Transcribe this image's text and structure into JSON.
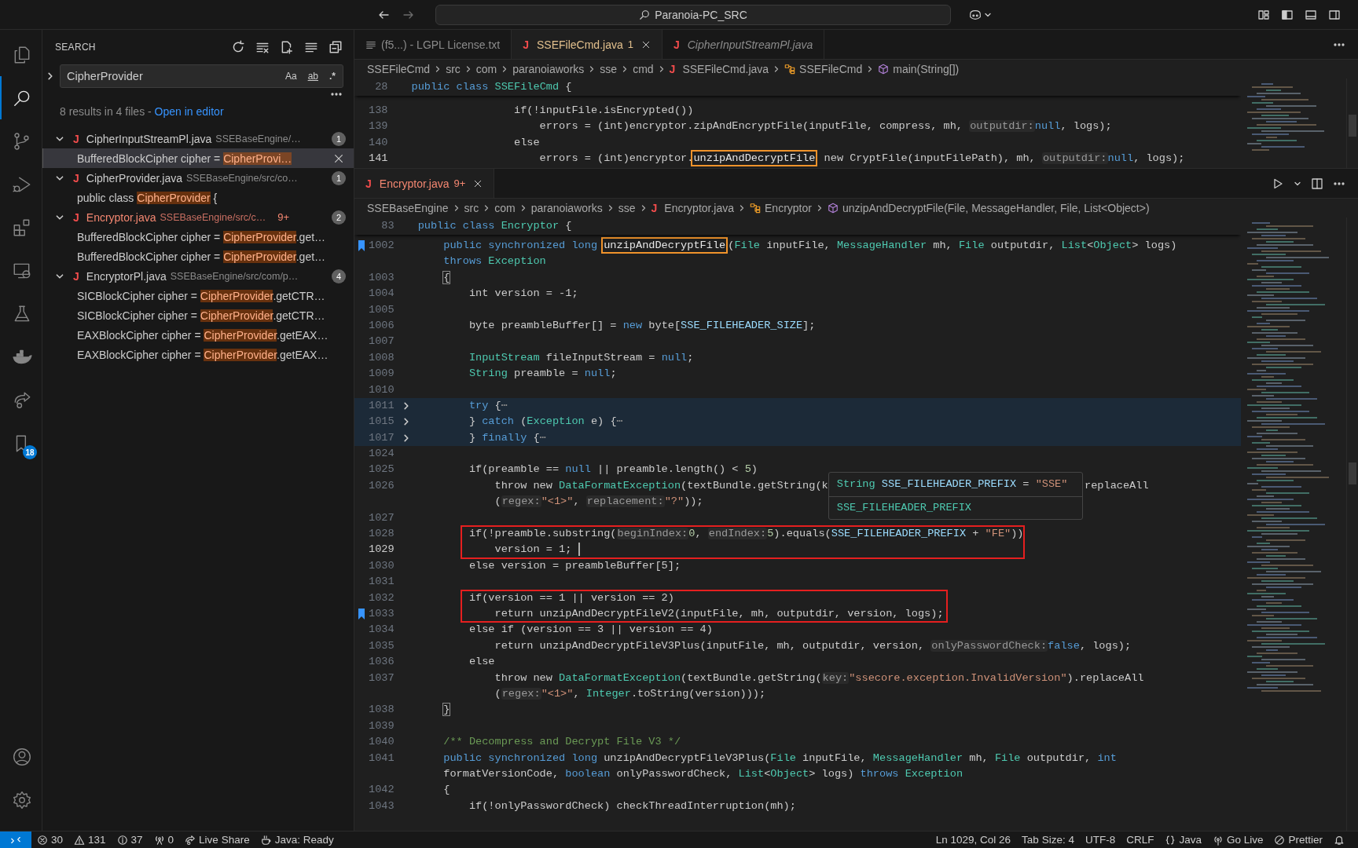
{
  "title_bar": {
    "search": "Paranoia-PC_SRC"
  },
  "activity_bar": {
    "top": [
      {
        "kind": "files",
        "selected": false
      },
      {
        "kind": "search",
        "selected": true
      },
      {
        "kind": "scm",
        "selected": false
      },
      {
        "kind": "debug",
        "selected": false
      },
      {
        "kind": "extensions",
        "selected": false
      },
      {
        "kind": "remote",
        "selected": false
      },
      {
        "kind": "testing",
        "selected": false
      },
      {
        "kind": "docker",
        "selected": false
      },
      {
        "kind": "liveshare",
        "selected": false
      },
      {
        "kind": "bookmarks",
        "selected": false,
        "badge": "18"
      }
    ],
    "bottom": [
      {
        "kind": "account"
      },
      {
        "kind": "settings"
      }
    ]
  },
  "sidebar": {
    "title": "SEARCH",
    "query": "CipherProvider",
    "options": [
      {
        "label": "Aa",
        "on": false
      },
      {
        "label": "ab",
        "on": false
      },
      {
        "label": ".*",
        "on": false
      }
    ],
    "summary": "8 results in 4 files - ",
    "link": "Open in editor",
    "files": [
      {
        "icon": "J",
        "name": "CipherInputStreamPl.java",
        "path": "SSEBaseEngine/…",
        "count": "1",
        "expanded": true,
        "error": false,
        "matches": [
          {
            "before": "BufferedBlockCipher cipher = ",
            "match": "CipherProvi…",
            "selected": true
          }
        ]
      },
      {
        "icon": "J",
        "name": "CipherProvider.java",
        "path": "SSEBaseEngine/src/co…",
        "count": "1",
        "expanded": true,
        "error": false,
        "matches": [
          {
            "before": "public class ",
            "match": "CipherProvider",
            "after": " {",
            "selected": false
          }
        ]
      },
      {
        "icon": "J",
        "name": "Encryptor.java",
        "path": "SSEBaseEngine/src/c…",
        "problems": "9+",
        "count": "2",
        "expanded": true,
        "error": true,
        "matches": [
          {
            "before": "BufferedBlockCipher cipher = ",
            "match": "CipherProvider",
            "after": ".get…",
            "selected": false
          },
          {
            "before": "BufferedBlockCipher cipher = ",
            "match": "CipherProvider",
            "after": ".get…",
            "selected": false
          }
        ]
      },
      {
        "icon": "J",
        "name": "EncryptorPl.java",
        "path": "SSEBaseEngine/src/com/p…",
        "count": "4",
        "expanded": true,
        "error": false,
        "matches": [
          {
            "before": "SICBlockCipher cipher = ",
            "match": "CipherProvider",
            "after": ".getCTR…",
            "selected": false
          },
          {
            "before": "SICBlockCipher cipher = ",
            "match": "CipherProvider",
            "after": ".getCTR…",
            "selected": false
          },
          {
            "before": "EAXBlockCipher cipher = ",
            "match": "CipherProvider",
            "after": ".getEAX…",
            "selected": false
          },
          {
            "before": "EAXBlockCipher cipher = ",
            "match": "CipherProvider",
            "after": ".getEAX…",
            "selected": false
          }
        ]
      }
    ]
  },
  "editor_top": {
    "tabs": [
      {
        "kind": "text",
        "label": "(f5...) - LGPL License.txt",
        "selected": false,
        "preview": false
      },
      {
        "kind": "java",
        "icon": "J",
        "label": "SSEFileCmd.java",
        "problems": "1",
        "warning": true,
        "selected": true,
        "preview": false
      },
      {
        "kind": "java",
        "icon": "J",
        "label": "CipherInputStreamPl.java",
        "selected": false,
        "preview": true
      }
    ],
    "breadcrumbs": [
      {
        "kind": "folder",
        "text": "SSEFileCmd"
      },
      {
        "kind": "folder",
        "text": "src"
      },
      {
        "kind": "folder",
        "text": "com"
      },
      {
        "kind": "folder",
        "text": "paranoiaworks"
      },
      {
        "kind": "folder",
        "text": "sse"
      },
      {
        "kind": "folder",
        "text": "cmd"
      },
      {
        "kind": "java",
        "icon": "J",
        "text": "SSEFileCmd.java"
      },
      {
        "kind": "class",
        "text": "SSEFileCmd"
      },
      {
        "kind": "method",
        "text": "main(String[])"
      }
    ],
    "sticky": {
      "number": "28",
      "segments": [
        [
          {
            "kind": "kw",
            "text": "public class "
          },
          {
            "kind": "type",
            "text": "SSEFileCmd"
          },
          {
            "kind": "plain",
            "text": " {"
          }
        ]
      ]
    },
    "lines": [
      {
        "kind": "line",
        "number": "138",
        "segments": [
          [
            {
              "kind": "plain",
              "text": "                if(!inputFile.isEncrypted())"
            }
          ]
        ]
      },
      {
        "kind": "line",
        "number": "139",
        "segments": [
          [
            {
              "kind": "plain",
              "text": "                    errors = (int)encryptor.zipAndEncryptFile(inputFile, compress, mh, "
            },
            {
              "kind": "hint",
              "text": "outputdir:"
            },
            {
              "kind": "kw",
              "text": "null"
            },
            {
              "kind": "plain",
              "text": ", logs);"
            }
          ]
        ]
      },
      {
        "kind": "line",
        "number": "140",
        "segments": [
          [
            {
              "kind": "plain",
              "text": "                else"
            }
          ]
        ]
      },
      {
        "kind": "line",
        "number": "141",
        "current": true,
        "segments": [
          [
            {
              "kind": "plain",
              "text": "                    errors = (int)encryptor."
            },
            {
              "kind": "boxed",
              "text": "unzipAndDecryptFile"
            },
            {
              "kind": "plain",
              "text": " new CryptFile(inputFilePath), mh, "
            },
            {
              "kind": "hint",
              "text": "outputdir:"
            },
            {
              "kind": "kw",
              "text": "null"
            },
            {
              "kind": "plain",
              "text": ", logs);"
            }
          ]
        ]
      }
    ]
  },
  "editor_bottom": {
    "tabs": [
      {
        "kind": "java",
        "icon": "J",
        "label": "Encryptor.java",
        "problems": "9+",
        "error": true,
        "selected": true,
        "preview": false
      }
    ],
    "breadcrumbs": [
      {
        "kind": "folder",
        "text": "SSEBaseEngine"
      },
      {
        "kind": "folder",
        "text": "src"
      },
      {
        "kind": "folder",
        "text": "com"
      },
      {
        "kind": "folder",
        "text": "paranoiaworks"
      },
      {
        "kind": "folder",
        "text": "sse"
      },
      {
        "kind": "java",
        "icon": "J",
        "text": "Encryptor.java"
      },
      {
        "kind": "class",
        "text": "Encryptor"
      },
      {
        "kind": "method",
        "text": "unzipAndDecryptFile(File, MessageHandler, File, List<Object>)"
      }
    ],
    "sticky": {
      "number": "83",
      "segments": [
        [
          {
            "kind": "kw",
            "text": "public class "
          },
          {
            "kind": "type",
            "text": "Encryptor"
          },
          {
            "kind": "plain",
            "text": " {"
          }
        ]
      ]
    },
    "lines": [
      {
        "kind": "line",
        "number": "1002",
        "bookmark": true,
        "segments": [
          [
            {
              "kind": "kw",
              "text": "    public synchronized long "
            },
            {
              "kind": "boxed",
              "text": "unzipAndDecryptFile"
            },
            {
              "kind": "plain",
              "text": "("
            },
            {
              "kind": "type",
              "text": "File"
            },
            {
              "kind": "plain",
              "text": " inputFile, "
            },
            {
              "kind": "type",
              "text": "MessageHandler"
            },
            {
              "kind": "plain",
              "text": " mh, "
            },
            {
              "kind": "type",
              "text": "File"
            },
            {
              "kind": "plain",
              "text": " outputdir, "
            },
            {
              "kind": "type",
              "text": "List"
            },
            {
              "kind": "plain",
              "text": "<"
            },
            {
              "kind": "type",
              "text": "Object"
            },
            {
              "kind": "plain",
              "text": "> logs)"
            }
          ],
          [
            {
              "kind": "kw",
              "text": "    throws "
            },
            {
              "kind": "type",
              "text": "Exception"
            }
          ]
        ]
      },
      {
        "kind": "line",
        "number": "1003",
        "segments": [
          [
            {
              "kind": "bracket",
              "text": "    {"
            }
          ]
        ]
      },
      {
        "kind": "line",
        "number": "1004",
        "segments": [
          [
            {
              "kind": "plain",
              "text": "        int version = -1;"
            }
          ]
        ]
      },
      {
        "kind": "line",
        "number": "1005"
      },
      {
        "kind": "line",
        "number": "1006",
        "segments": [
          [
            {
              "kind": "plain",
              "text": "        byte preambleBuffer[] = "
            },
            {
              "kind": "kw",
              "text": "new"
            },
            {
              "kind": "plain",
              "text": " byte["
            },
            {
              "kind": "var",
              "text": "SSE_FILEHEADER_SIZE"
            },
            {
              "kind": "plain",
              "text": "];"
            }
          ]
        ]
      },
      {
        "kind": "line",
        "number": "1007"
      },
      {
        "kind": "line",
        "number": "1008",
        "segments": [
          [
            {
              "kind": "type",
              "text": "        InputStream"
            },
            {
              "kind": "plain",
              "text": " fileInputStream = "
            },
            {
              "kind": "kw",
              "text": "null"
            },
            {
              "kind": "plain",
              "text": ";"
            }
          ]
        ]
      },
      {
        "kind": "line",
        "number": "1009",
        "segments": [
          [
            {
              "kind": "type",
              "text": "        String"
            },
            {
              "kind": "plain",
              "text": " preamble = "
            },
            {
              "kind": "kw",
              "text": "null"
            },
            {
              "kind": "plain",
              "text": ";"
            }
          ]
        ]
      },
      {
        "kind": "line",
        "number": "1010"
      },
      {
        "kind": "line",
        "number": "1011",
        "foldable": true,
        "highlighted": true,
        "segments": [
          [
            {
              "kind": "kw",
              "text": "        try"
            },
            {
              "kind": "plain",
              "text": " {"
            },
            {
              "kind": "fold",
              "text": "⋯"
            }
          ]
        ]
      },
      {
        "kind": "line",
        "number": "1015",
        "foldable": true,
        "highlighted": true,
        "segments": [
          [
            {
              "kind": "plain",
              "text": "        } "
            },
            {
              "kind": "kw",
              "text": "catch"
            },
            {
              "kind": "plain",
              "text": " ("
            },
            {
              "kind": "type",
              "text": "Exception"
            },
            {
              "kind": "plain",
              "text": " e) {"
            },
            {
              "kind": "fold",
              "text": "⋯"
            }
          ]
        ]
      },
      {
        "kind": "line",
        "number": "1017",
        "foldable": true,
        "highlighted": true,
        "segments": [
          [
            {
              "kind": "plain",
              "text": "        } "
            },
            {
              "kind": "kw",
              "text": "finally"
            },
            {
              "kind": "plain",
              "text": " {"
            },
            {
              "kind": "fold",
              "text": "⋯"
            }
          ]
        ]
      },
      {
        "kind": "line",
        "number": "1024"
      },
      {
        "kind": "line",
        "number": "1025",
        "segments": [
          [
            {
              "kind": "plain",
              "text": "        if(preamble == "
            },
            {
              "kind": "kw",
              "text": "null"
            },
            {
              "kind": "plain",
              "text": " || preamble.length() < "
            },
            {
              "kind": "num",
              "text": "5"
            },
            {
              "kind": "plain",
              "text": ")"
            }
          ]
        ]
      },
      {
        "kind": "line",
        "number": "1026",
        "hover": {
          "signature": [
            {
              "kind": "type",
              "text": "String"
            },
            {
              "kind": "var",
              "text": " SSE_FILEHEADER_PREFIX"
            },
            {
              "kind": "plain",
              "text": " = "
            },
            {
              "kind": "str",
              "text": "\"SSE\""
            }
          ],
          "name": "SSE_FILEHEADER_PREFIX"
        },
        "segments": [
          [
            {
              "kind": "plain",
              "text": "            throw new "
            },
            {
              "kind": "type",
              "text": "DataFormatException"
            },
            {
              "kind": "plain",
              "text": "(textBundle.getString(k"
            },
            {
              "kind": "covered"
            },
            {
              "kind": "plain",
              "text": "replaceAll"
            }
          ],
          [
            {
              "kind": "plain",
              "text": "            ("
            },
            {
              "kind": "hint",
              "text": "regex:"
            },
            {
              "kind": "str",
              "text": "\"<1>\""
            },
            {
              "kind": "plain",
              "text": ", "
            },
            {
              "kind": "hint",
              "text": "replacement:"
            },
            {
              "kind": "str",
              "text": "\"?\""
            },
            {
              "kind": "plain",
              "text": "));"
            }
          ]
        ]
      },
      {
        "kind": "line",
        "number": "1027"
      },
      {
        "kind": "group",
        "lines": [
          {
            "kind": "line",
            "number": "1028",
            "segments": [
              [
                {
                  "kind": "plain",
                  "text": "        if(!preamble.substring("
                },
                {
                  "kind": "hint",
                  "text": "beginIndex:"
                },
                {
                  "kind": "num",
                  "text": "0"
                },
                {
                  "kind": "plain",
                  "text": ", "
                },
                {
                  "kind": "hint",
                  "text": "endIndex:"
                },
                {
                  "kind": "num",
                  "text": "5"
                },
                {
                  "kind": "plain",
                  "text": ").equals("
                },
                {
                  "kind": "var",
                  "text": "SSE_FILEHEADER_PREFIX"
                },
                {
                  "kind": "plain",
                  "text": " + "
                },
                {
                  "kind": "str",
                  "text": "\"FE\""
                },
                {
                  "kind": "plain",
                  "text": "))"
                }
              ]
            ]
          },
          {
            "kind": "line",
            "number": "1029",
            "current": true,
            "cursor": true,
            "segments": [
              [
                {
                  "kind": "plain",
                  "text": "            version = 1; "
                }
              ]
            ]
          }
        ]
      },
      {
        "kind": "line",
        "number": "1030",
        "segments": [
          [
            {
              "kind": "plain",
              "text": "        else version = preambleBuffer[5];"
            }
          ]
        ]
      },
      {
        "kind": "line",
        "number": "1031"
      },
      {
        "kind": "group",
        "lines": [
          {
            "kind": "line",
            "number": "1032",
            "segments": [
              [
                {
                  "kind": "plain",
                  "text": "        if(version == 1 || version == 2)"
                }
              ]
            ]
          },
          {
            "kind": "line",
            "number": "1033",
            "bookmark": true,
            "segments": [
              [
                {
                  "kind": "plain",
                  "text": "            return unzipAndDecryptFileV2(inputFile, mh, outputdir, version, logs);"
                }
              ]
            ]
          }
        ]
      },
      {
        "kind": "line",
        "number": "1034",
        "segments": [
          [
            {
              "kind": "plain",
              "text": "        else if (version == 3 || version == 4)"
            }
          ]
        ]
      },
      {
        "kind": "line",
        "number": "1035",
        "segments": [
          [
            {
              "kind": "plain",
              "text": "            return unzipAndDecryptFileV3Plus(inputFile, mh, outputdir, version, "
            },
            {
              "kind": "hint",
              "text": "onlyPasswordCheck:"
            },
            {
              "kind": "kw",
              "text": "false"
            },
            {
              "kind": "plain",
              "text": ", logs);"
            }
          ]
        ]
      },
      {
        "kind": "line",
        "number": "1036",
        "segments": [
          [
            {
              "kind": "plain",
              "text": "        else"
            }
          ]
        ]
      },
      {
        "kind": "line",
        "number": "1037",
        "segments": [
          [
            {
              "kind": "plain",
              "text": "            throw new "
            },
            {
              "kind": "type",
              "text": "DataFormatException"
            },
            {
              "kind": "plain",
              "text": "(textBundle.getString("
            },
            {
              "kind": "hint",
              "text": "key:"
            },
            {
              "kind": "str",
              "text": "\"ssecore.exception.InvalidVersion\""
            },
            {
              "kind": "plain",
              "text": ").replaceAll"
            }
          ],
          [
            {
              "kind": "plain",
              "text": "            ("
            },
            {
              "kind": "hint",
              "text": "regex:"
            },
            {
              "kind": "str",
              "text": "\"<1>\""
            },
            {
              "kind": "plain",
              "text": ", "
            },
            {
              "kind": "type",
              "text": "Integer"
            },
            {
              "kind": "plain",
              "text": ".toString(version)));"
            }
          ]
        ]
      },
      {
        "kind": "line",
        "number": "1038",
        "segments": [
          [
            {
              "kind": "bracket",
              "text": "    }"
            }
          ]
        ]
      },
      {
        "kind": "line",
        "number": "1039"
      },
      {
        "kind": "line",
        "number": "1040",
        "segments": [
          [
            {
              "kind": "comment",
              "text": "    /** Decompress and Decrypt File V3 */"
            }
          ]
        ]
      },
      {
        "kind": "line",
        "number": "1041",
        "segments": [
          [
            {
              "kind": "kw",
              "text": "    public synchronized long "
            },
            {
              "kind": "plain",
              "text": "unzipAndDecryptFileV3Plus("
            },
            {
              "kind": "type",
              "text": "File"
            },
            {
              "kind": "plain",
              "text": " inputFile, "
            },
            {
              "kind": "type",
              "text": "MessageHandler"
            },
            {
              "kind": "plain",
              "text": " mh, "
            },
            {
              "kind": "type",
              "text": "File"
            },
            {
              "kind": "plain",
              "text": " outputdir, "
            },
            {
              "kind": "kw",
              "text": "int"
            }
          ],
          [
            {
              "kind": "plain",
              "text": "    formatVersionCode, "
            },
            {
              "kind": "kw",
              "text": "boolean"
            },
            {
              "kind": "plain",
              "text": " onlyPasswordCheck, "
            },
            {
              "kind": "type",
              "text": "List"
            },
            {
              "kind": "plain",
              "text": "<"
            },
            {
              "kind": "type",
              "text": "Object"
            },
            {
              "kind": "plain",
              "text": "> logs) "
            },
            {
              "kind": "kw",
              "text": "throws "
            },
            {
              "kind": "type",
              "text": "Exception"
            }
          ]
        ]
      },
      {
        "kind": "line",
        "number": "1042",
        "segments": [
          [
            {
              "kind": "plain",
              "text": "    {"
            }
          ]
        ]
      },
      {
        "kind": "line",
        "number": "1043",
        "segments": [
          [
            {
              "kind": "plain",
              "text": "        if(!onlyPasswordCheck) checkThreadInterruption(mh);"
            }
          ]
        ]
      }
    ]
  },
  "status_bar": {
    "left": [
      {
        "kind": "remote"
      },
      {
        "kind": "errors",
        "text": "30"
      },
      {
        "kind": "warnings",
        "text": "131"
      },
      {
        "kind": "infos",
        "text": "37"
      },
      {
        "kind": "ports",
        "text": "0"
      },
      {
        "kind": "liveshare",
        "text": "Live Share"
      },
      {
        "kind": "java",
        "text": "Java: Ready"
      }
    ],
    "right": [
      {
        "kind": "plain",
        "text": "Ln 1029, Col 26"
      },
      {
        "kind": "plain",
        "text": "Tab Size: 4"
      },
      {
        "kind": "plain",
        "text": "UTF-8"
      },
      {
        "kind": "plain",
        "text": "CRLF"
      },
      {
        "kind": "language",
        "text": "Java"
      },
      {
        "kind": "golive",
        "text": "Go Live"
      },
      {
        "kind": "prettier",
        "text": "Prettier"
      },
      {
        "kind": "bell"
      }
    ]
  }
}
